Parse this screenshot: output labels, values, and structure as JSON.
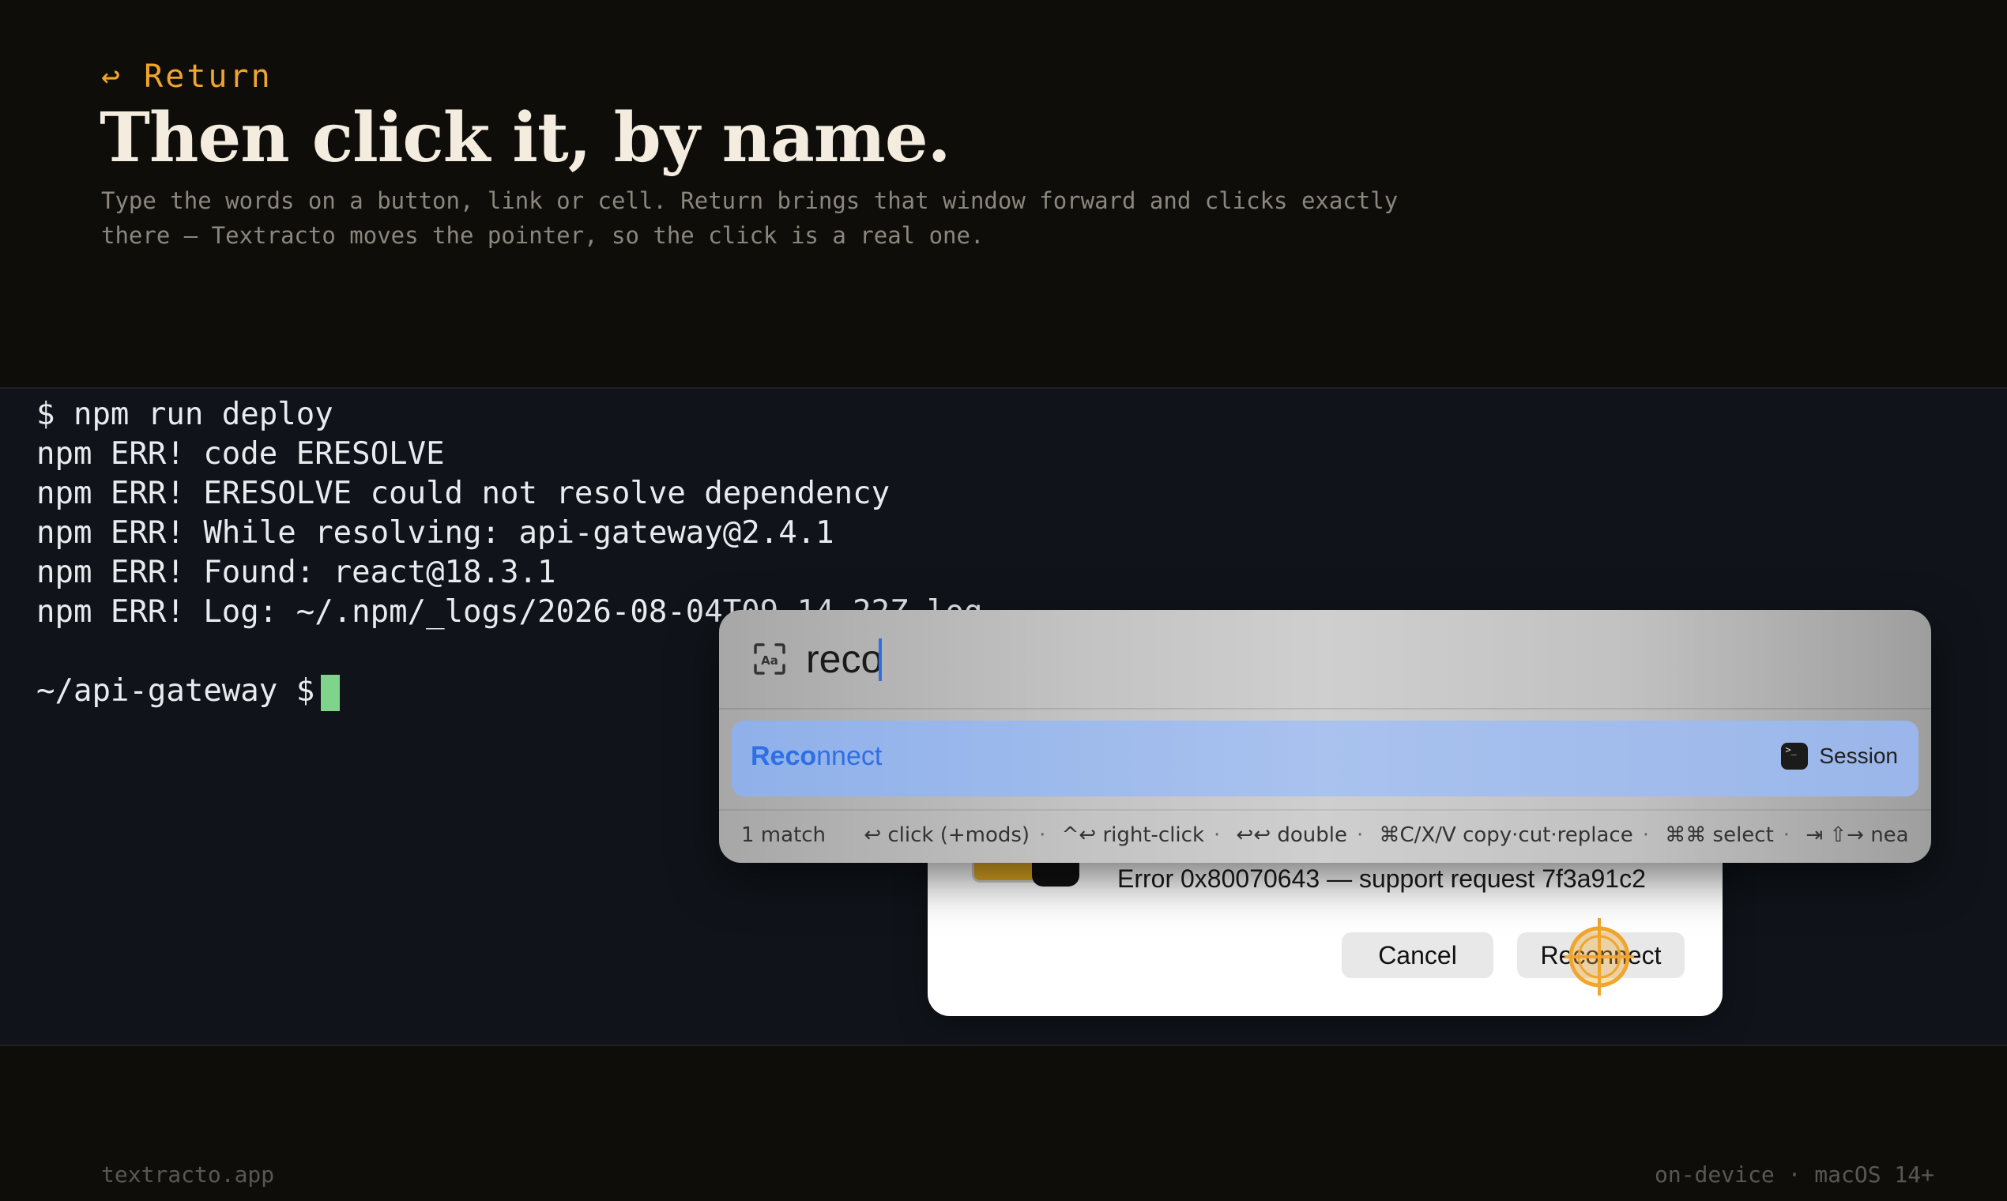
{
  "header": {
    "kicker": "↩ Return",
    "headline": "Then click it, by name.",
    "description_line1": "Type the words on a button, link or cell. Return brings that window forward and clicks exactly",
    "description_line2": "there — Textracto moves the pointer, so the click is a real one."
  },
  "terminal": {
    "lines": [
      "$ npm run deploy",
      "npm ERR! code ERESOLVE",
      "npm ERR! ERESOLVE could not resolve dependency",
      "npm ERR! While resolving: api-gateway@2.4.1",
      "npm ERR! Found: react@18.3.1",
      "npm ERR! Log: ~/.npm/_logs/2026-08-04T09_14_22Z.log",
      "",
      "~/api-gateway $"
    ]
  },
  "dialog": {
    "message": "Error 0x80070643 — support request 7f3a91c2",
    "cancel_label": "Cancel",
    "reconnect_label": "Reconnect"
  },
  "search": {
    "query": "reco",
    "result": {
      "match_text": "Reco",
      "rest_text": "nnect",
      "app_name": "Session"
    },
    "footer": {
      "count": "1 match",
      "hints": [
        "↩ click (+mods)",
        "^↩ right-click",
        "↩↩ double",
        "⌘C/X/V copy·cut·replace",
        "⌘⌘ select",
        "⇥ ⇧→ nea..."
      ]
    }
  },
  "footer": {
    "left": "textracto.app",
    "right": "on-device · macOS 14+"
  },
  "colors": {
    "accent": "#f0a52b",
    "terminal_cursor": "#7fd38a",
    "match_blue": "#2f6fe4"
  }
}
